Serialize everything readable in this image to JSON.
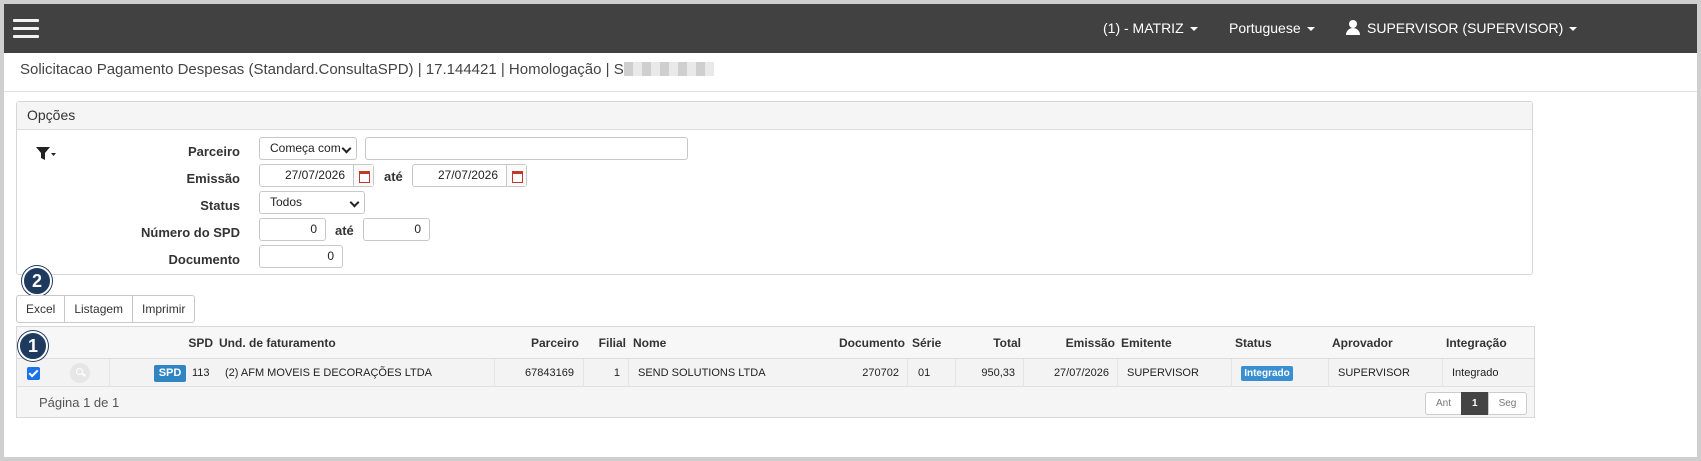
{
  "header": {
    "branch_label": "(1) - MATRIZ",
    "language_label": "Portuguese",
    "user_label": "SUPERVISOR (SUPERVISOR)"
  },
  "page": {
    "title": "Solicitacao Pagamento Despesas (Standard.ConsultaSPD) | 17.144421 | Homologação | S"
  },
  "options": {
    "heading": "Opções",
    "fields": {
      "parceiro": {
        "label": "Parceiro",
        "mode": "Começa com",
        "value": ""
      },
      "emissao": {
        "label": "Emissão",
        "from": "27/07/2026",
        "to_label": "até",
        "to": "27/07/2026"
      },
      "status": {
        "label": "Status",
        "value": "Todos"
      },
      "numero_spd": {
        "label": "Número do SPD",
        "from": "0",
        "to_label": "até",
        "to": "0"
      },
      "documento": {
        "label": "Documento",
        "value": "0"
      }
    }
  },
  "callouts": {
    "one": "1",
    "two": "2"
  },
  "toolbar": {
    "excel": "Excel",
    "listagem": "Listagem",
    "imprimir": "Imprimir"
  },
  "table": {
    "columns": {
      "spd": "SPD",
      "und": "Und. de faturamento",
      "parceiro": "Parceiro",
      "filial": "Filial",
      "nome": "Nome",
      "documento": "Documento",
      "serie": "Série",
      "total": "Total",
      "emissao": "Emissão",
      "emitente": "Emitente",
      "status": "Status",
      "aprovador": "Aprovador",
      "integracao": "Integração"
    },
    "rows": [
      {
        "checked": true,
        "spd_button": "SPD",
        "spd": "113",
        "und": "(2) AFM MOVEIS E DECORAÇÕES LTDA",
        "parceiro": "67843169",
        "filial": "1",
        "nome": "SEND SOLUTIONS LTDA",
        "documento": "270702",
        "serie": "01",
        "total": "950,33",
        "emissao": "27/07/2026",
        "emitente": "SUPERVISOR",
        "status": "Integrado",
        "aprovador": "SUPERVISOR",
        "integracao": "Integrado"
      }
    ],
    "pagination_text": "Página 1 de 1",
    "pager": {
      "prev": "Ant",
      "current": "1",
      "next": "Seg"
    }
  },
  "colors": {
    "topbar": "#414141",
    "accent": "#2f86c3",
    "callout": "#1f3a5f"
  }
}
